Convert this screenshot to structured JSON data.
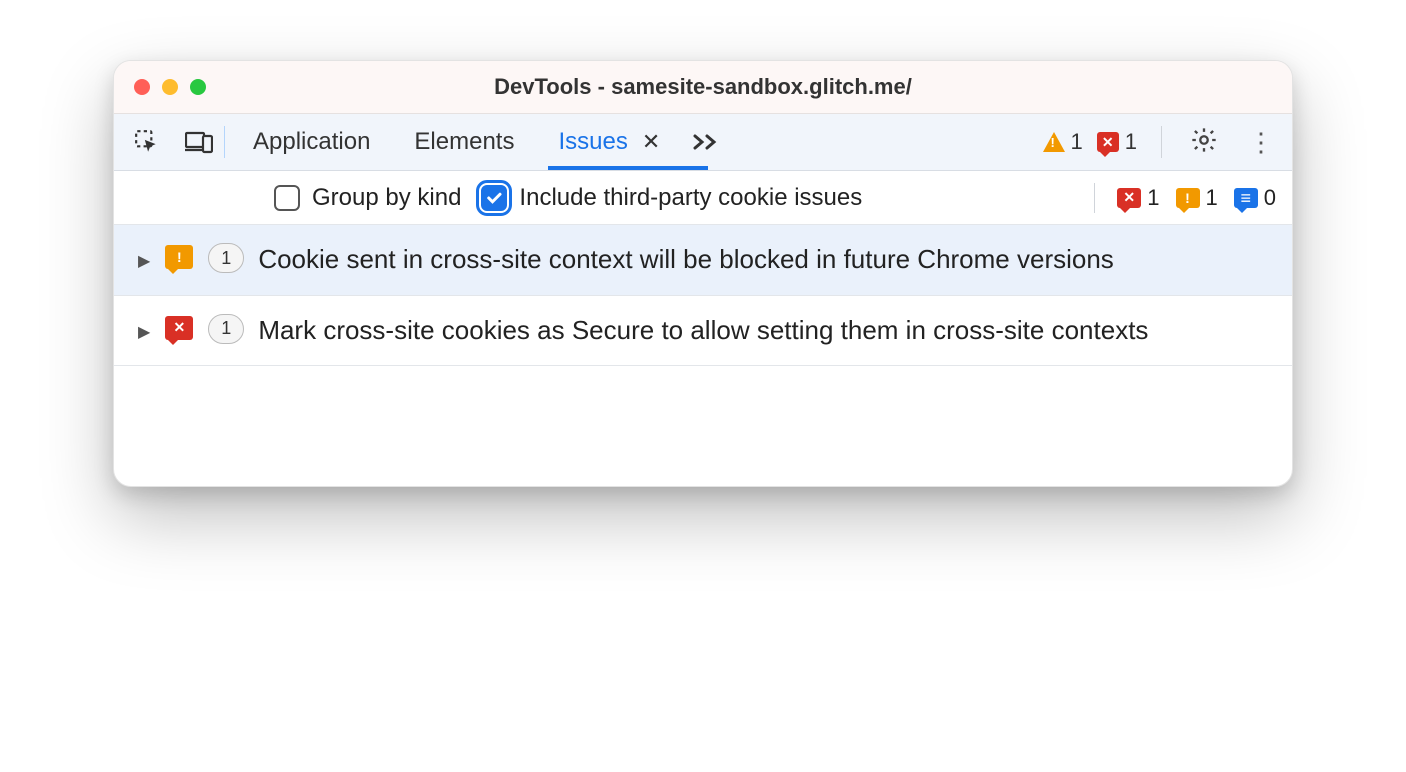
{
  "window": {
    "title": "DevTools - samesite-sandbox.glitch.me/"
  },
  "tabs": {
    "items": [
      "Application",
      "Elements",
      "Issues"
    ],
    "active_index": 2
  },
  "header_badges": {
    "warning_count": "1",
    "error_count": "1"
  },
  "subbar": {
    "group_by_kind": {
      "label": "Group by kind",
      "checked": false
    },
    "include_third_party": {
      "label": "Include third-party cookie issues",
      "checked": true
    },
    "counts": {
      "error": "1",
      "warning": "1",
      "info": "0"
    }
  },
  "issues": [
    {
      "severity": "warning",
      "count": "1",
      "title": "Cookie sent in cross-site context will be blocked in future Chrome versions",
      "highlighted": true
    },
    {
      "severity": "error",
      "count": "1",
      "title": "Mark cross-site cookies as Secure to allow setting them in cross-site contexts",
      "highlighted": false
    }
  ]
}
